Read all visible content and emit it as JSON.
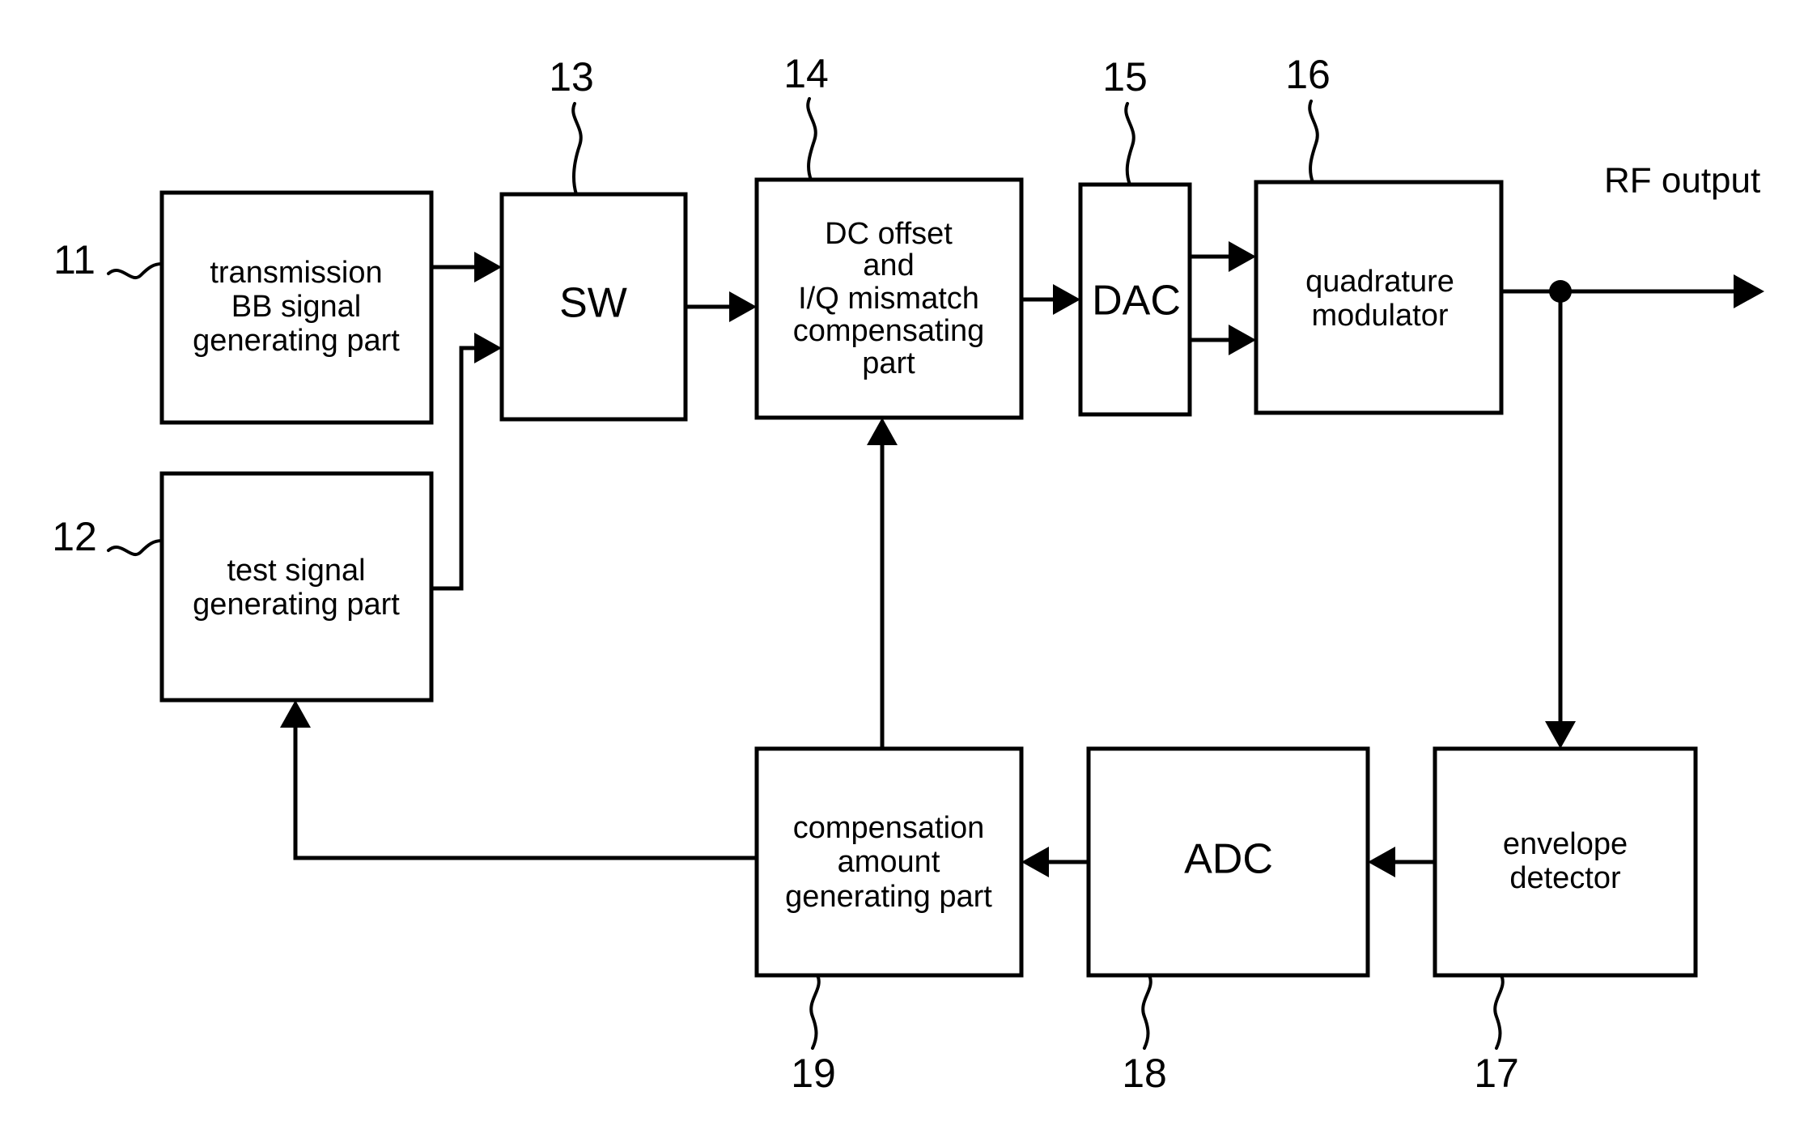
{
  "figure": {
    "type": "patent-block-diagram",
    "background_color": "#ffffff",
    "line_color": "#000000"
  },
  "blocks": [
    {
      "id": "transmission-bb",
      "ref": "11",
      "lines": [
        "transmission",
        "BB signal",
        "generating part"
      ]
    },
    {
      "id": "test-signal",
      "ref": "12",
      "lines": [
        "test signal",
        "generating part"
      ]
    },
    {
      "id": "sw",
      "ref": "13",
      "lines": [
        "SW"
      ]
    },
    {
      "id": "dc-offset",
      "ref": "14",
      "lines": [
        "DC offset",
        "and",
        "I/Q mismatch",
        "compensating",
        "part"
      ]
    },
    {
      "id": "dac",
      "ref": "15",
      "lines": [
        "DAC"
      ]
    },
    {
      "id": "quadrature-modulator",
      "ref": "16",
      "lines": [
        "quadrature",
        "modulator"
      ]
    },
    {
      "id": "envelope-detector",
      "ref": "17",
      "lines": [
        "envelope",
        "detector"
      ]
    },
    {
      "id": "adc",
      "ref": "18",
      "lines": [
        "ADC"
      ]
    },
    {
      "id": "compensation-amount",
      "ref": "19",
      "lines": [
        "compensation",
        "amount",
        "generating part"
      ]
    }
  ],
  "labels": {
    "rf_output": "RF output"
  }
}
